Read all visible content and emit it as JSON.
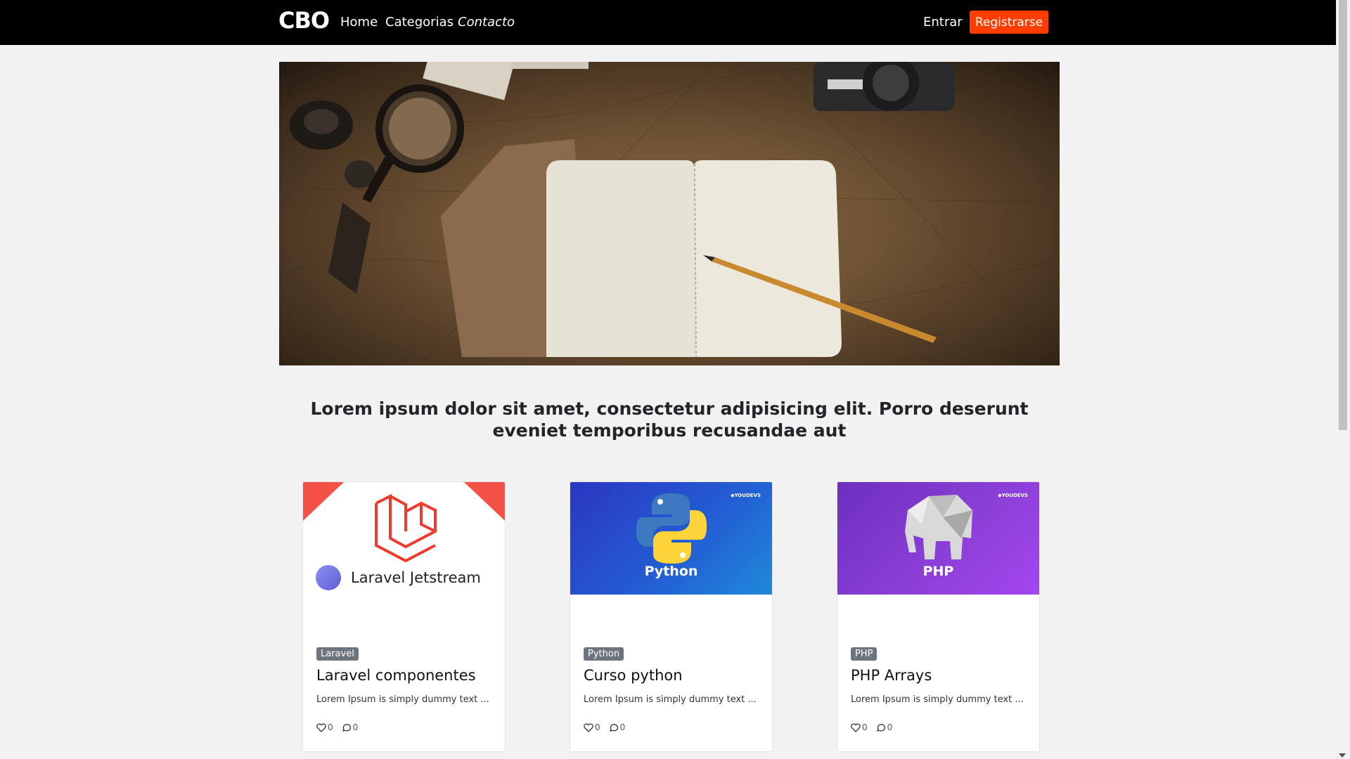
{
  "nav": {
    "brand": "CBO",
    "links": [
      "Home",
      "Categorias",
      "Contacto"
    ],
    "login": "Entrar",
    "register": "Registrarse"
  },
  "intro": "Lorem ipsum dolor sit amet, consectetur adipisicing elit. Porro deserunt eveniet temporibus recusandae aut",
  "cards": [
    {
      "tag": "Laravel",
      "title": "Laravel componentes",
      "excerpt": "Lorem Ipsum is simply dummy text ...",
      "likes": "0",
      "comments": "0",
      "logo_text": "Laravel Jetstream"
    },
    {
      "tag": "Python",
      "title": "Curso python",
      "excerpt": "Lorem Ipsum is simply dummy text ...",
      "likes": "0",
      "comments": "0",
      "logo_text": "Python"
    },
    {
      "tag": "PHP",
      "title": "PHP Arrays",
      "excerpt": "Lorem Ipsum is simply dummy text ...",
      "likes": "0",
      "comments": "0",
      "logo_text": "PHP"
    }
  ],
  "colors": {
    "accent": "#ff3d00",
    "python_bg": "#2a43c4",
    "php_bg": "#8b3fd6",
    "laravel_red": "#ef3b2d"
  }
}
